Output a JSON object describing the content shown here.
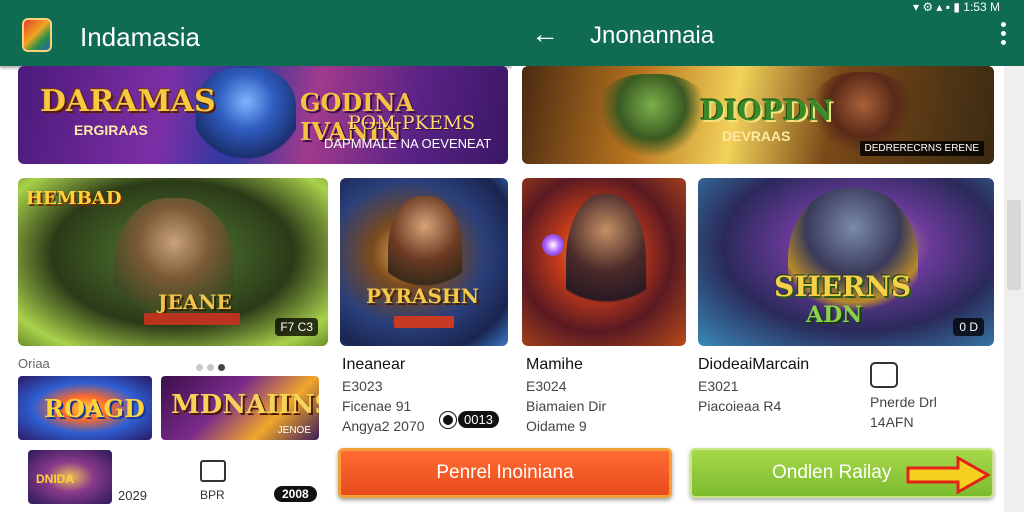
{
  "left": {
    "app_title": "Indamasia",
    "banner": {
      "title": "DARAMAS",
      "subtitle": "ERGIRAAS",
      "mid_title": "GODINA IVANIN",
      "mid_subtitle": "POM PKEMS",
      "caption": "DAPMMALE NA OEVENEAT"
    },
    "card_a": {
      "logo": "HEMBAD",
      "name": "JEANE",
      "badge": "F7 C3"
    },
    "card_b": {
      "name": "PYRASHN"
    },
    "section_label": "Oriaa",
    "thumb_1": {
      "text": "ROAGD"
    },
    "thumb_2": {
      "text": "MDNAIINS",
      "sub": "JENOE"
    },
    "info": {
      "name": "Ineanear",
      "line1": "E3023",
      "line2": "Ficenae 91",
      "line3": "Angya2 2070",
      "count": "0013"
    },
    "row3": {
      "thumb_text": "DNIDA",
      "num": "2029",
      "label": "BPR",
      "pill": "2008"
    }
  },
  "right": {
    "status": "▾ ⚙ ▴ ▪ ▮ 1:53 M",
    "title": "Jnonannaia",
    "banner": {
      "title": "DIOPDN",
      "subtitle": "DEVRAAS",
      "tag": "DEDRERECRNS ERENE"
    },
    "card_d": {
      "title": "SHERNS",
      "sub": "ADN",
      "badge": "0 D"
    },
    "info_1": {
      "name": "Mamihe",
      "line1": "E3024",
      "line2": "Biamaien Dir",
      "line3": "Oidame 9"
    },
    "info_2": {
      "name": "DiodeaiMarcain",
      "line1": "E3021",
      "line2": "Piacoieaa R4"
    },
    "info_3": {
      "line2": "Pnerde Drl",
      "line3": "14AFN"
    }
  },
  "buttons": {
    "orange_label": "Penrel Inoiniana",
    "green_label": "Ondlen Railay"
  },
  "colors": {
    "appbar": "#0f6b52",
    "accent_orange": "#e94b1c",
    "accent_green": "#7dbb2e"
  },
  "icons": [
    "app-logo-icon",
    "back-arrow-icon",
    "more-vert-icon",
    "arrow-right-icon"
  ]
}
